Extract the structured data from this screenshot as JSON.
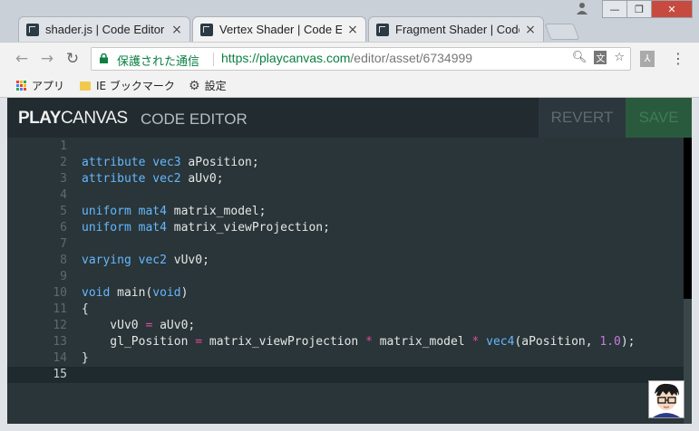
{
  "browser": {
    "tabs": [
      {
        "title": "shader.js | Code Editor",
        "close": "×"
      },
      {
        "title": "Vertex Shader | Code Ed",
        "close": "×"
      },
      {
        "title": "Fragment Shader | Code Ed",
        "close": "×"
      }
    ],
    "window_controls": {
      "minimize": "—",
      "maximize": "❐",
      "close": "✕"
    },
    "nav": {
      "back": "←",
      "forward": "→",
      "reload": "↻"
    },
    "omnibox": {
      "security_label": "保護された通信",
      "url_host": "https://playcanvas.com",
      "url_path": "/editor/asset/6734999"
    },
    "bookmarks": [
      {
        "label": "アプリ",
        "icon": "apps-grid-icon"
      },
      {
        "label": "IE ブックマーク",
        "icon": "folder-icon"
      },
      {
        "label": "設定",
        "icon": "gear-icon"
      }
    ]
  },
  "editor_header": {
    "logo_bold": "PLAY",
    "logo_thin": "CANVAS",
    "subtitle": "CODE EDITOR",
    "revert_label": "REVERT",
    "save_label": "SAVE"
  },
  "code": {
    "active_line": 15,
    "lines": [
      {
        "n": "1",
        "tokens": []
      },
      {
        "n": "2",
        "tokens": [
          [
            "kw",
            "attribute"
          ],
          [
            "t",
            " "
          ],
          [
            "kw",
            "vec3"
          ],
          [
            "t",
            " aPosition;"
          ]
        ]
      },
      {
        "n": "3",
        "tokens": [
          [
            "kw",
            "attribute"
          ],
          [
            "t",
            " "
          ],
          [
            "kw",
            "vec2"
          ],
          [
            "t",
            " aUv0;"
          ]
        ]
      },
      {
        "n": "4",
        "tokens": []
      },
      {
        "n": "5",
        "tokens": [
          [
            "kw",
            "uniform"
          ],
          [
            "t",
            " "
          ],
          [
            "kw",
            "mat4"
          ],
          [
            "t",
            " matrix_model;"
          ]
        ]
      },
      {
        "n": "6",
        "tokens": [
          [
            "kw",
            "uniform"
          ],
          [
            "t",
            " "
          ],
          [
            "kw",
            "mat4"
          ],
          [
            "t",
            " matrix_viewProjection;"
          ]
        ]
      },
      {
        "n": "7",
        "tokens": []
      },
      {
        "n": "8",
        "tokens": [
          [
            "kw",
            "varying"
          ],
          [
            "t",
            " "
          ],
          [
            "kw",
            "vec2"
          ],
          [
            "t",
            " vUv0;"
          ]
        ]
      },
      {
        "n": "9",
        "tokens": []
      },
      {
        "n": "10",
        "tokens": [
          [
            "kw",
            "void"
          ],
          [
            "t",
            " main("
          ],
          [
            "kw",
            "void"
          ],
          [
            "t",
            ")"
          ]
        ]
      },
      {
        "n": "11",
        "tokens": [
          [
            "t",
            "{"
          ]
        ]
      },
      {
        "n": "12",
        "tokens": [
          [
            "t",
            "    vUv0 "
          ],
          [
            "op",
            "="
          ],
          [
            "t",
            " aUv0;"
          ]
        ]
      },
      {
        "n": "13",
        "tokens": [
          [
            "t",
            "    gl_Position "
          ],
          [
            "op",
            "="
          ],
          [
            "t",
            " matrix_viewProjection "
          ],
          [
            "op",
            "*"
          ],
          [
            "t",
            " matrix_model "
          ],
          [
            "op",
            "*"
          ],
          [
            "t",
            " "
          ],
          [
            "kw",
            "vec4"
          ],
          [
            "t",
            "(aPosition, "
          ],
          [
            "num",
            "1.0"
          ],
          [
            "t",
            ");"
          ]
        ]
      },
      {
        "n": "14",
        "tokens": [
          [
            "t",
            "}"
          ]
        ]
      },
      {
        "n": "15",
        "tokens": []
      }
    ]
  },
  "colors": {
    "keyword": "#66b7ff",
    "operator": "#e04b9c",
    "number": "#c678dd",
    "editor_bg": "#293538",
    "header_bg": "#212b30"
  }
}
